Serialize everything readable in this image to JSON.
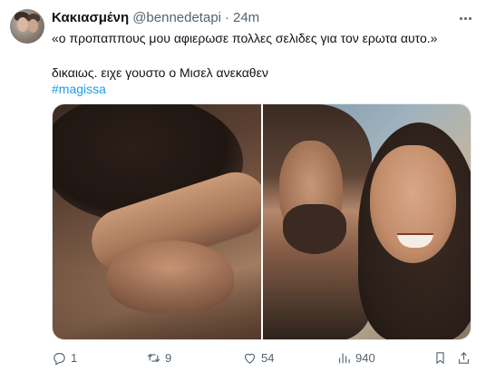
{
  "tweet": {
    "author_name": "Κακιασμένη",
    "author_handle": "@bennedetapi",
    "separator": "·",
    "time": "24m",
    "line1": "«ο προπαππους μου αφιερωσε πολλες σελιδες για τον ερωτα αυτο.»",
    "line2": "δικαιως. ειχε γουστο ο Μισελ ανεκαθεν",
    "hashtag": "#magissa"
  },
  "media": {
    "images": [
      "photo-embrace",
      "photo-smiling-couple"
    ]
  },
  "actions": {
    "replies": "1",
    "reposts": "9",
    "likes": "54",
    "views": "940"
  },
  "icons": {
    "reply": "comment-icon",
    "repost": "repost-icon",
    "like": "heart-icon",
    "views": "views-chart-icon",
    "bookmark": "bookmark-icon",
    "share": "share-icon",
    "more": "more-dots-icon"
  },
  "colors": {
    "link": "#1d9bf0",
    "muted": "#536471",
    "text": "#0f1419"
  }
}
